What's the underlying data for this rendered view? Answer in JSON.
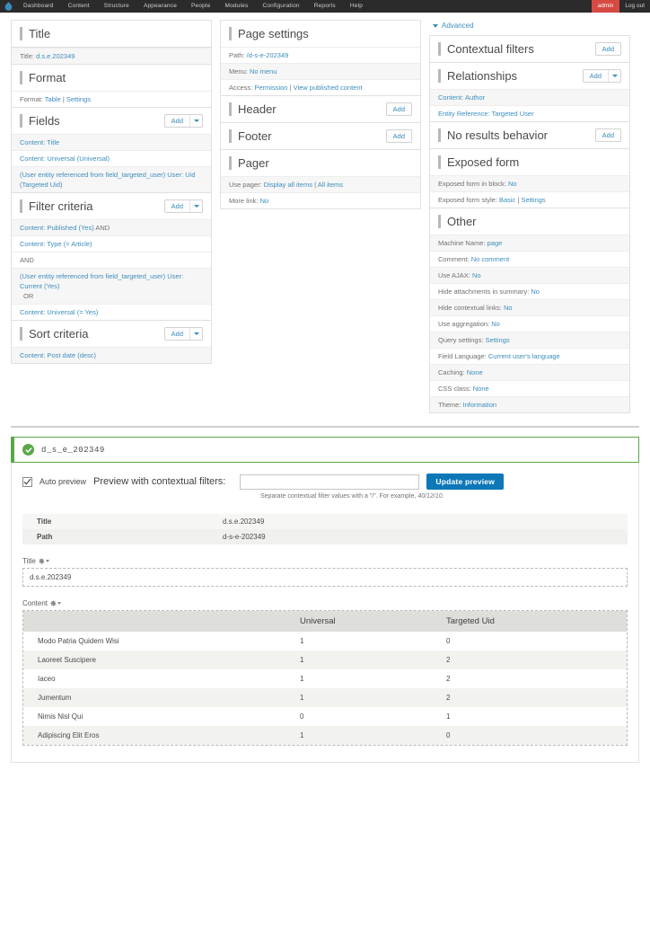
{
  "toolbar": {
    "logo_icon": "drupal-drop-icon",
    "items": [
      "Dashboard",
      "Content",
      "Structure",
      "Appearance",
      "People",
      "Modules",
      "Configuration",
      "Reports",
      "Help"
    ],
    "user": "admin",
    "logout": "Log out"
  },
  "left_column": {
    "title_section": {
      "heading": "Title",
      "rows": [
        {
          "label": "Title:",
          "value": "d.s.e.202349"
        }
      ]
    },
    "format_section": {
      "heading": "Format",
      "label": "Format:",
      "value": "Table",
      "sep": "|",
      "settings": "Settings"
    },
    "fields_section": {
      "heading": "Fields",
      "add_label": "Add",
      "items": [
        "Content: Title",
        "Content: Universal (Universal)",
        "(User entity referenced from field_targeted_user) User: Uid (Targeted Uid)"
      ]
    },
    "filter_section": {
      "heading": "Filter criteria",
      "add_label": "Add",
      "items": [
        {
          "text": "Content: Published (Yes)",
          "op": "AND"
        },
        {
          "text": "Content: Type (= Article)",
          "op": ""
        },
        {
          "text": "",
          "op": "AND"
        },
        {
          "text": "(User entity referenced from field_targeted_user) User: Current (Yes)",
          "op": "OR"
        },
        {
          "text": "Content: Universal (= Yes)",
          "op": ""
        }
      ]
    },
    "sort_section": {
      "heading": "Sort criteria",
      "add_label": "Add",
      "items": [
        "Content: Post date (desc)"
      ]
    }
  },
  "middle_column": {
    "page_settings": {
      "heading": "Page settings",
      "rows": [
        {
          "label": "Path:",
          "value": "/d-s-e-202349"
        },
        {
          "label": "Menu:",
          "value": "No menu"
        },
        {
          "label": "Access:",
          "value": "Permission",
          "sep": "|",
          "extra": "View published content"
        }
      ]
    },
    "header_section": {
      "heading": "Header",
      "add_label": "Add"
    },
    "footer_section": {
      "heading": "Footer",
      "add_label": "Add"
    },
    "pager_section": {
      "heading": "Pager",
      "rows": [
        {
          "label": "Use pager:",
          "value": "Display all items",
          "sep": "|",
          "extra": "All items"
        },
        {
          "label": "More link:",
          "value": "No"
        }
      ]
    }
  },
  "right_column": {
    "advanced_label": "Advanced",
    "contextual_filters": {
      "heading": "Contextual filters",
      "add_label": "Add"
    },
    "relationships": {
      "heading": "Relationships",
      "add_label": "Add",
      "items": [
        "Content: Author",
        "Entity Reference: Targeted User"
      ]
    },
    "no_results": {
      "heading": "No results behavior",
      "add_label": "Add"
    },
    "exposed_form": {
      "heading": "Exposed form",
      "rows": [
        {
          "label": "Exposed form in block:",
          "value": "No"
        },
        {
          "label": "Exposed form style:",
          "value": "Basic",
          "sep": "|",
          "extra": "Settings"
        }
      ]
    },
    "other": {
      "heading": "Other",
      "rows": [
        {
          "label": "Machine Name:",
          "value": "page"
        },
        {
          "label": "Comment:",
          "value": "No comment"
        },
        {
          "label": "Use AJAX:",
          "value": "No"
        },
        {
          "label": "Hide attachments in summary:",
          "value": "No"
        },
        {
          "label": "Hide contextual links:",
          "value": "No"
        },
        {
          "label": "Use aggregation:",
          "value": "No"
        },
        {
          "label": "Query settings:",
          "value": "Settings"
        },
        {
          "label": "Field Language:",
          "value": "Current user's language"
        },
        {
          "label": "Caching:",
          "value": "None"
        },
        {
          "label": "CSS class:",
          "value": "None"
        },
        {
          "label": "Theme:",
          "value": "Information"
        }
      ]
    }
  },
  "preview": {
    "status_icon": "success-check-icon",
    "status_text": "d_s_e_202349",
    "auto_preview_label": "Auto preview",
    "auto_preview_checked": true,
    "contextual_label": "Preview with contextual filters:",
    "contextual_value": "",
    "contextual_placeholder": "",
    "update_button": "Update preview",
    "hint_prefix": "Separate contextual filter values with a \"/\". For example, ",
    "hint_example": "40/12/10.",
    "summary": [
      {
        "key": "Title",
        "value": "d.s.e.202349",
        "is_link": false
      },
      {
        "key": "Path",
        "value": "d-s-e-202349",
        "is_link": true
      }
    ],
    "title_block": {
      "label": "Title",
      "gear_icon": "gear-icon",
      "value": "d.s.e.202349"
    },
    "content_block": {
      "label": "Content",
      "gear_icon": "gear-icon"
    },
    "results_table": {
      "columns": [
        "",
        "Universal",
        "Targeted Uid"
      ],
      "rows": [
        {
          "title": "Modo Patria Quidem Wisi",
          "universal": "1",
          "targeted_uid": "0"
        },
        {
          "title": "Laoreet Suscipere",
          "universal": "1",
          "targeted_uid": "2"
        },
        {
          "title": "Iaceo",
          "universal": "1",
          "targeted_uid": "2"
        },
        {
          "title": "Jumentum",
          "universal": "1",
          "targeted_uid": "2"
        },
        {
          "title": "Nimis Nisl Qui",
          "universal": "0",
          "targeted_uid": "1"
        },
        {
          "title": "Adipiscing Elit Eros",
          "universal": "1",
          "targeted_uid": "0"
        }
      ]
    }
  },
  "colors": {
    "toolbar_bg": "#2b2b2b",
    "user_badge": "#d64a43",
    "link": "#3c8dbc",
    "primary_button": "#0d77b8",
    "success": "#5aa74a"
  }
}
